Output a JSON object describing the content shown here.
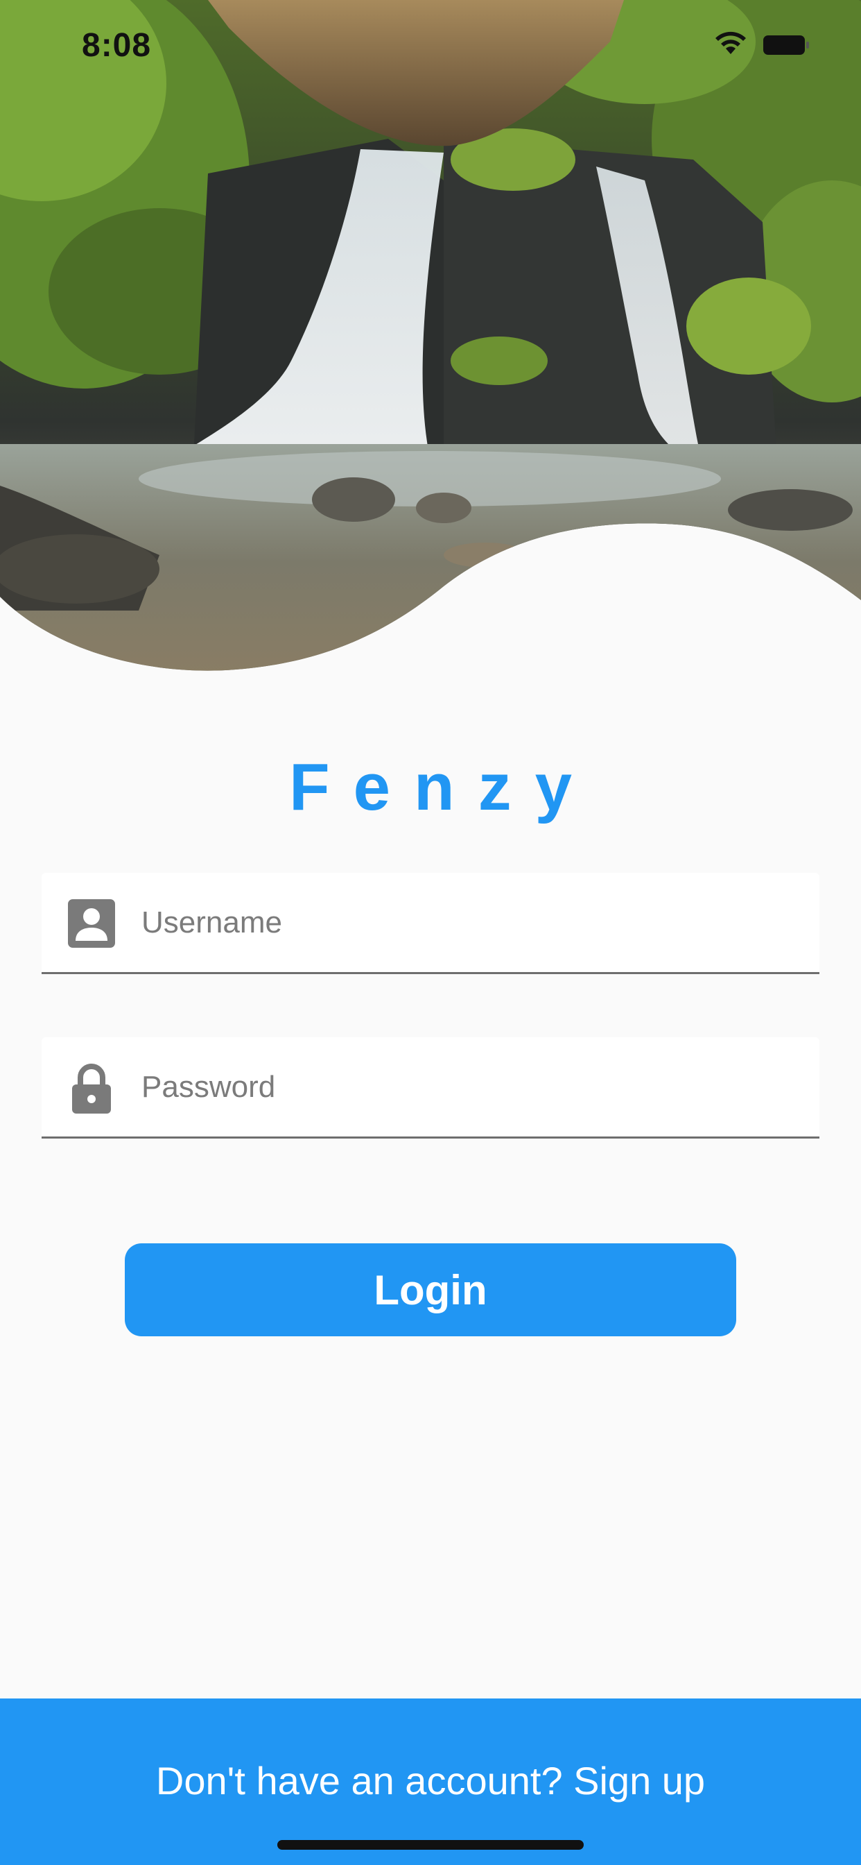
{
  "status_bar": {
    "time": "8:08",
    "wifi_icon": "wifi-icon",
    "battery_icon": "battery-icon"
  },
  "hero": {
    "image": "waterfall-forest-photo"
  },
  "brand": {
    "title": "Fenzy",
    "color": "#2196f3"
  },
  "form": {
    "username": {
      "icon": "account-box-icon",
      "placeholder": "Username",
      "value": ""
    },
    "password": {
      "icon": "lock-icon",
      "placeholder": "Password",
      "value": ""
    },
    "login_label": "Login"
  },
  "footer": {
    "signup_text": "Don't have an account? Sign up",
    "background": "#2196f3"
  },
  "colors": {
    "accent": "#2196f3",
    "page_background": "#fafafa",
    "icon_gray": "#7a7a7a"
  }
}
